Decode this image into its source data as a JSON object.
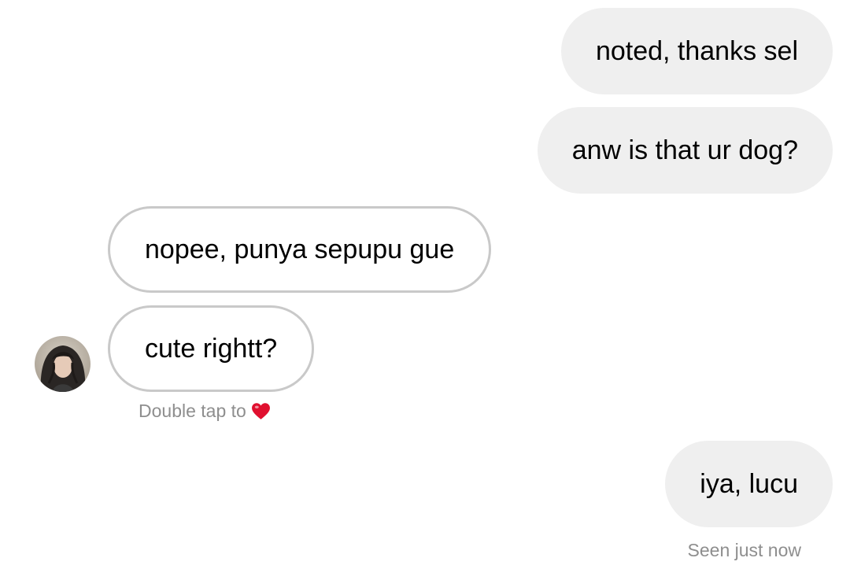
{
  "conversation": {
    "messages": [
      {
        "side": "sent",
        "text": "noted, thanks sel"
      },
      {
        "side": "sent",
        "text": "anw is that ur dog?"
      },
      {
        "side": "received",
        "text": "nopee, punya sepupu gue"
      },
      {
        "side": "received",
        "text": "cute rightt?"
      },
      {
        "side": "sent",
        "text": "iya, lucu"
      }
    ],
    "double_tap_hint": "Double tap to",
    "seen_status": "Seen just now"
  },
  "icons": {
    "heart": "heart-icon",
    "avatar": "contact-avatar"
  },
  "colors": {
    "sent_bubble": "#efefef",
    "received_border": "#c9c9c9",
    "meta_text": "#8e8e8e",
    "heart": "#e0102f"
  }
}
